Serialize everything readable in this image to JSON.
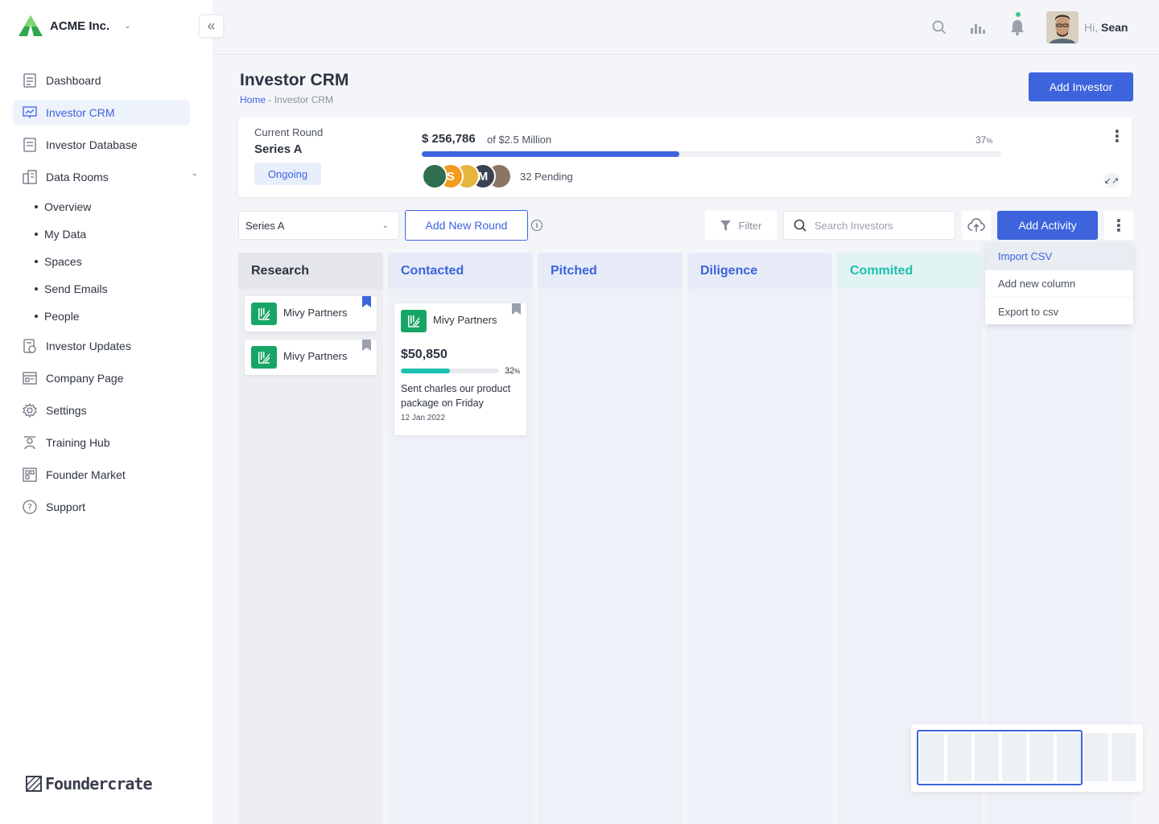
{
  "brand": {
    "name": "ACME Inc."
  },
  "sidebar": {
    "items": [
      {
        "label": "Dashboard",
        "icon": "dashboard-icon"
      },
      {
        "label": "Investor CRM",
        "icon": "presentation-icon",
        "active": true
      },
      {
        "label": "Investor Database",
        "icon": "database-icon"
      },
      {
        "label": "Data Rooms",
        "icon": "building-icon",
        "expanded": true
      }
    ],
    "sub_items": [
      "Overview",
      "My Data",
      "Spaces",
      "Send Emails",
      "People"
    ],
    "items_after": [
      {
        "label": "Investor Updates",
        "icon": "update-icon"
      },
      {
        "label": "Company Page",
        "icon": "company-icon"
      },
      {
        "label": "Settings",
        "icon": "gear-icon"
      },
      {
        "label": "Training Hub",
        "icon": "training-icon"
      },
      {
        "label": "Founder Market",
        "icon": "market-icon"
      },
      {
        "label": "Support",
        "icon": "help-icon"
      }
    ],
    "footer_brand": "Foundercrate"
  },
  "topbar": {
    "greeting_prefix": "Hi,",
    "user_name": "Sean"
  },
  "header": {
    "title": "Investor CRM",
    "breadcrumb_home": "Home",
    "breadcrumb_sep": " - ",
    "breadcrumb_current": "Investor CRM",
    "add_investor": "Add Investor"
  },
  "round": {
    "label": "Current Round",
    "name": "Series A",
    "status": "Ongoing",
    "raised": "$ 256,786",
    "target": "of $2.5 Million",
    "percent": "37",
    "percent_unit": "%",
    "progress": 0.445,
    "avatars": [
      {
        "letter": "",
        "color": "#2f6e4f"
      },
      {
        "letter": "S",
        "color": "#f49a1c"
      },
      {
        "letter": "",
        "color": "#e6b53e"
      },
      {
        "letter": "M",
        "color": "#3b4150"
      },
      {
        "letter": "",
        "color": "#8a7566"
      }
    ],
    "pending": "32 Pending"
  },
  "toolbar": {
    "round_select": "Series A",
    "add_round": "Add New Round",
    "filter": "Filter",
    "search_placeholder": "Search Investors",
    "add_activity": "Add Activity"
  },
  "columns": [
    {
      "title": "Research",
      "head_bg": "#e4e6eb",
      "body_bg": "#eceef2",
      "color": "#2d3340"
    },
    {
      "title": "Contacted",
      "head_bg": "#e6ebf7",
      "body_bg": "#eef1f7",
      "color": "#3d63dd"
    },
    {
      "title": "Pitched",
      "head_bg": "#e6ebf7",
      "body_bg": "#eef1f7",
      "color": "#3d63dd"
    },
    {
      "title": "Diligence",
      "head_bg": "#e6ebf7",
      "body_bg": "#eef1f7",
      "color": "#3d63dd"
    },
    {
      "title": "Commited",
      "head_bg": "#e2f3f3",
      "body_bg": "#eef1f7",
      "color": "#1bbfb0"
    }
  ],
  "cards": {
    "research": [
      {
        "company": "Mivy Partners",
        "bookmarked": true
      },
      {
        "company": "Mivy Partners",
        "bookmarked": false
      }
    ],
    "contacted": {
      "company": "Mivy Partners",
      "amount": "$50,850",
      "percent": "32",
      "percent_unit": "%",
      "progress": 0.5,
      "note": "Sent charles our product package on Friday",
      "date": "12 Jan 2022"
    }
  },
  "dropdown": [
    "Import CSV",
    "Add new column",
    "Export to csv"
  ],
  "colors": {
    "accent": "#3d63dd",
    "green": "#17a566",
    "teal": "#1bbfb0"
  }
}
